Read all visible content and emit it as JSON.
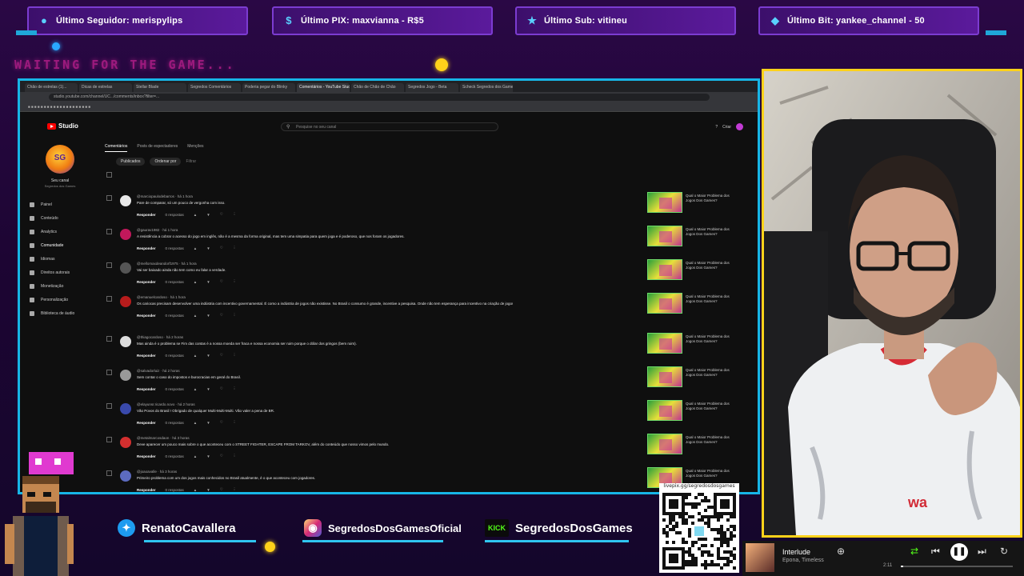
{
  "alerts": [
    {
      "icon": "user-icon",
      "text": "Último Seguidor: merispylips"
    },
    {
      "icon": "dollar-icon",
      "text": "Último PIX: maxvianna - R$5"
    },
    {
      "icon": "star-icon",
      "text": "Último Sub: vitineu"
    },
    {
      "icon": "bits-icon",
      "text": "Último Bit: yankee_channel - 50"
    }
  ],
  "overlay": {
    "waiting": "WAITING FOR THE GAME..."
  },
  "browser": {
    "tabs": [
      "Chão de estrelas (1)...",
      "Dicas de estrelas",
      "Stellar Blade",
      "Segredos Comentários",
      "Poderia pegar do Blinky",
      "Comentários - YouTube Studio",
      "Chão de Chão de Chão",
      "Segredos Jogo - Beta",
      "Scheck Segredos dos Games"
    ],
    "url": "studio.youtube.com/channel/UC.../comments/inbox?filter=..."
  },
  "yt": {
    "logo": "Studio",
    "search_placeholder": "Pesquise no seu canal",
    "create": "Criar",
    "channel_name": "Seu canal",
    "channel_sub": "Segredos dos Games",
    "nav": [
      "Painel",
      "Conteúdo",
      "Analytics",
      "Comunidade",
      "Idiomas",
      "Direitos autorais",
      "Monetização",
      "Personalização",
      "Biblioteca de áudio"
    ],
    "subtabs": [
      "Comentários",
      "Posts de espectadores",
      "Menções"
    ],
    "filter_chip": "Publicados",
    "sort_chip": "Ordenar por",
    "filter_label": "Filtrar",
    "reply_label": "Responder",
    "replies_label": "0 respostas",
    "video_title": "Qual o Maior Problema dos Jogos Dos Games?",
    "comments": [
      {
        "author": "@marciopaulodebarros · há 1 hora",
        "text": "Pare de comparar, só um pouco de vergonha com isso."
      },
      {
        "author": "@gaurav1982 · há 1 hora",
        "text": "A resistência a cobrar o acesso do jogo em inglês, não é a mesma da forma original, mas tem uma simpatia para quem joga e é poderoso, que nos foram os jogadores."
      },
      {
        "author": "@mellomaxdeandorf1975 · há 1 hora",
        "text": "Vai ser baixado ainda não tem como eu falar a verdade."
      },
      {
        "author": "@emanuelcardoso · há 1 hora",
        "text": "Os cariocas precisam desenvolver uma indústria com incentivo governamental. É como a indústria de jogos não existisse. No Brasil o consumo é grande, incentive a pesquisa. Onde não tem esperança para incentivo na criação de jogos aqui."
      },
      {
        "author": "@thiagocardoso · há 2 horas",
        "text": "Mas ainda é o problema se Fim das contas é a nossa moeda ser fraca e nossa economia ser ruim porque o dólar dos gringos (bem ruim)."
      },
      {
        "author": "@salvadorluiz · há 2 horas",
        "text": "Sem contar o caso do impostos e burocracias em geral do Brasil."
      },
      {
        "author": "@elayunsr.ricardo.novo · há 2 horas",
        "text": "Vão Povos do Brasil ! Obrigado de qualquer Multi-Multi-Multi. Vão valer a pena de BR."
      },
      {
        "author": "@metalmarcosdaon · há 3 horas",
        "text": "Deve aparecer um pouco mais sobre o que aconteceu com o STREET FIGHTER, ESCAPE FROM TARKOV, além do conteúdo que nosso vimos pelo mundo."
      },
      {
        "author": "@joaoavalle · há 3 horas",
        "text": "Primeiro problema com um dos jogos mais conhecidos no Brasil atualmente, é o que aconteceu com jogadores."
      }
    ]
  },
  "socials": [
    {
      "icon": "twitter-icon",
      "handle": "RenatoCavallera"
    },
    {
      "icon": "instagram-icon",
      "handle": "SegredosDosGamesOficial"
    },
    {
      "icon": "kick-icon",
      "badge": "KICK",
      "handle": "SegredosDosGames"
    }
  ],
  "qr": {
    "url": "livepix.gg/segredosdosgames"
  },
  "player": {
    "song": "Interlude",
    "artist": "Epona, Timeless",
    "time": "2:11",
    "progress": 0.02
  },
  "colors": {
    "accent": "#17b5e6",
    "cam_border": "#ffd21a",
    "bg": "#24063a"
  }
}
